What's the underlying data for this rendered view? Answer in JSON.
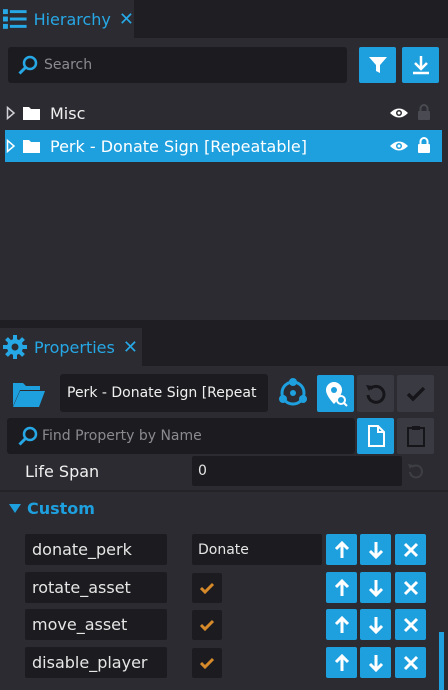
{
  "hierarchy": {
    "tab_label": "Hierarchy",
    "search_placeholder": "Search",
    "items": [
      {
        "label": "Misc"
      },
      {
        "label": "Perk - Donate Sign [Repeatable]"
      }
    ]
  },
  "properties": {
    "tab_label": "Properties",
    "object_name": "Perk - Donate Sign [Repeat",
    "find_placeholder": "Find Property by Name",
    "life_span_label": "Life Span",
    "life_span_value": "0",
    "custom_label": "Custom",
    "custom": [
      {
        "name": "donate_perk",
        "value": "Donate",
        "type": "text"
      },
      {
        "name": "rotate_asset",
        "value": "",
        "type": "bool"
      },
      {
        "name": "move_asset",
        "value": "",
        "type": "bool"
      },
      {
        "name": "disable_player",
        "value": "",
        "type": "bool"
      }
    ]
  },
  "colors": {
    "accent": "#1ea0df",
    "check": "#d78a2a"
  }
}
